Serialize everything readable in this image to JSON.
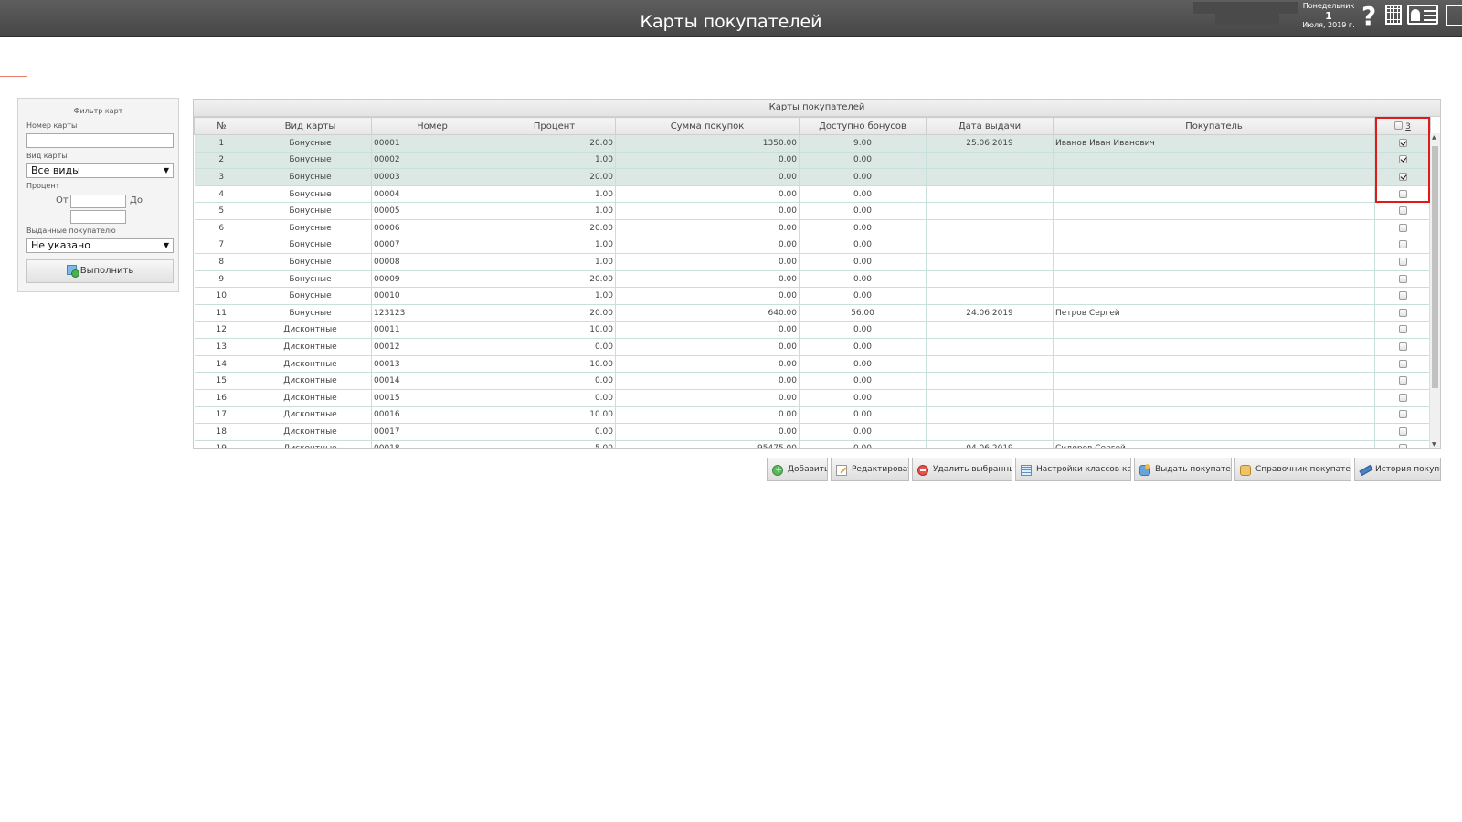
{
  "header": {
    "title": "Карты покупателей",
    "weekday": "Понедельник",
    "day": "1",
    "month_year": "Июля, 2019 г.",
    "help_label": "?"
  },
  "filter": {
    "title": "Фильтр карт",
    "card_number_label": "Номер карты",
    "card_number_value": "",
    "card_type_label": "Вид карты",
    "card_type_value": "Все виды",
    "percent_label": "Процент",
    "from_label": "От",
    "to_label": "До",
    "issued_label": "Выданные покупателю",
    "issued_value": "Не указано",
    "run_button": "Выполнить"
  },
  "grid": {
    "caption": "Карты покупателей",
    "columns": [
      "№",
      "Вид карты",
      "Номер",
      "Процент",
      "Сумма покупок",
      "Доступно бонусов",
      "Дата выдачи",
      "Покупатель"
    ],
    "selected_count": "3",
    "rows": [
      {
        "n": "1",
        "type": "Бонусные",
        "number": "00001",
        "percent": "20.00",
        "sum": "1350.00",
        "bonus": "9.00",
        "date": "25.06.2019",
        "buyer": "Иванов Иван Иванович",
        "checked": true
      },
      {
        "n": "2",
        "type": "Бонусные",
        "number": "00002",
        "percent": "1.00",
        "sum": "0.00",
        "bonus": "0.00",
        "date": "",
        "buyer": "",
        "checked": true
      },
      {
        "n": "3",
        "type": "Бонусные",
        "number": "00003",
        "percent": "20.00",
        "sum": "0.00",
        "bonus": "0.00",
        "date": "",
        "buyer": "",
        "checked": true
      },
      {
        "n": "4",
        "type": "Бонусные",
        "number": "00004",
        "percent": "1.00",
        "sum": "0.00",
        "bonus": "0.00",
        "date": "",
        "buyer": "",
        "checked": false
      },
      {
        "n": "5",
        "type": "Бонусные",
        "number": "00005",
        "percent": "1.00",
        "sum": "0.00",
        "bonus": "0.00",
        "date": "",
        "buyer": "",
        "checked": false
      },
      {
        "n": "6",
        "type": "Бонусные",
        "number": "00006",
        "percent": "20.00",
        "sum": "0.00",
        "bonus": "0.00",
        "date": "",
        "buyer": "",
        "checked": false
      },
      {
        "n": "7",
        "type": "Бонусные",
        "number": "00007",
        "percent": "1.00",
        "sum": "0.00",
        "bonus": "0.00",
        "date": "",
        "buyer": "",
        "checked": false
      },
      {
        "n": "8",
        "type": "Бонусные",
        "number": "00008",
        "percent": "1.00",
        "sum": "0.00",
        "bonus": "0.00",
        "date": "",
        "buyer": "",
        "checked": false
      },
      {
        "n": "9",
        "type": "Бонусные",
        "number": "00009",
        "percent": "20.00",
        "sum": "0.00",
        "bonus": "0.00",
        "date": "",
        "buyer": "",
        "checked": false
      },
      {
        "n": "10",
        "type": "Бонусные",
        "number": "00010",
        "percent": "1.00",
        "sum": "0.00",
        "bonus": "0.00",
        "date": "",
        "buyer": "",
        "checked": false
      },
      {
        "n": "11",
        "type": "Бонусные",
        "number": "123123",
        "percent": "20.00",
        "sum": "640.00",
        "bonus": "56.00",
        "date": "24.06.2019",
        "buyer": "Петров Сергей",
        "checked": false
      },
      {
        "n": "12",
        "type": "Дисконтные",
        "number": "00011",
        "percent": "10.00",
        "sum": "0.00",
        "bonus": "0.00",
        "date": "",
        "buyer": "",
        "checked": false
      },
      {
        "n": "13",
        "type": "Дисконтные",
        "number": "00012",
        "percent": "0.00",
        "sum": "0.00",
        "bonus": "0.00",
        "date": "",
        "buyer": "",
        "checked": false
      },
      {
        "n": "14",
        "type": "Дисконтные",
        "number": "00013",
        "percent": "10.00",
        "sum": "0.00",
        "bonus": "0.00",
        "date": "",
        "buyer": "",
        "checked": false
      },
      {
        "n": "15",
        "type": "Дисконтные",
        "number": "00014",
        "percent": "0.00",
        "sum": "0.00",
        "bonus": "0.00",
        "date": "",
        "buyer": "",
        "checked": false
      },
      {
        "n": "16",
        "type": "Дисконтные",
        "number": "00015",
        "percent": "0.00",
        "sum": "0.00",
        "bonus": "0.00",
        "date": "",
        "buyer": "",
        "checked": false
      },
      {
        "n": "17",
        "type": "Дисконтные",
        "number": "00016",
        "percent": "10.00",
        "sum": "0.00",
        "bonus": "0.00",
        "date": "",
        "buyer": "",
        "checked": false
      },
      {
        "n": "18",
        "type": "Дисконтные",
        "number": "00017",
        "percent": "0.00",
        "sum": "0.00",
        "bonus": "0.00",
        "date": "",
        "buyer": "",
        "checked": false
      },
      {
        "n": "19",
        "type": "Дисконтные",
        "number": "00018",
        "percent": "5.00",
        "sum": "95475.00",
        "bonus": "0.00",
        "date": "04.06.2019",
        "buyer": "Сидоров Сергей",
        "checked": false
      }
    ]
  },
  "actions": {
    "add": "Добавить",
    "edit": "Редактировать",
    "delete_selected": "Удалить выбранные",
    "class_settings": "Настройки классов карт",
    "issue_to_buyer": "Выдать покупателю",
    "buyers_directory": "Справочник покупателей",
    "history": "История покупок"
  },
  "colors": {
    "header_bg": "#4e4e4e",
    "selected_row": "#dce8e3",
    "highlight": "#e0191b"
  }
}
